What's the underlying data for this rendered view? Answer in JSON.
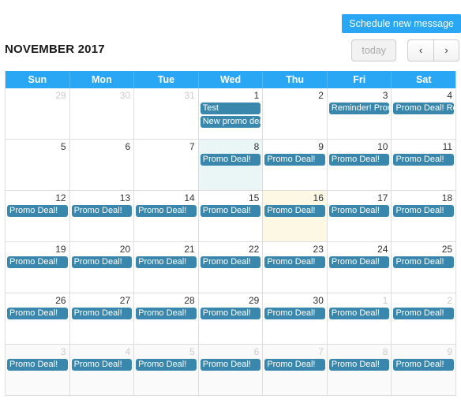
{
  "toolbar": {
    "schedule_label": "Schedule new message"
  },
  "header": {
    "title": "NOVEMBER 2017",
    "today_label": "today",
    "prev_label": "‹",
    "next_label": "›"
  },
  "calendar": {
    "day_names": [
      "Sun",
      "Mon",
      "Tue",
      "Wed",
      "Thu",
      "Fri",
      "Sat"
    ],
    "weeks": [
      [
        {
          "num": "29",
          "state": "other",
          "events": []
        },
        {
          "num": "30",
          "state": "other",
          "events": []
        },
        {
          "num": "31",
          "state": "other",
          "events": []
        },
        {
          "num": "1",
          "state": "current",
          "events": [
            "Test",
            "New promo deal"
          ]
        },
        {
          "num": "2",
          "state": "current",
          "events": []
        },
        {
          "num": "3",
          "state": "current",
          "events": [
            "Reminder! Prom"
          ]
        },
        {
          "num": "4",
          "state": "current",
          "events": [
            "Promo Deal! Rer"
          ]
        }
      ],
      [
        {
          "num": "5",
          "state": "current",
          "events": []
        },
        {
          "num": "6",
          "state": "current",
          "events": []
        },
        {
          "num": "7",
          "state": "current",
          "events": []
        },
        {
          "num": "8",
          "state": "tinted",
          "events": [
            "Promo Deal!"
          ]
        },
        {
          "num": "9",
          "state": "current",
          "events": [
            "Promo Deal!"
          ]
        },
        {
          "num": "10",
          "state": "current",
          "events": [
            "Promo Deal!"
          ]
        },
        {
          "num": "11",
          "state": "current",
          "events": [
            "Promo Deal!"
          ]
        }
      ],
      [
        {
          "num": "12",
          "state": "current",
          "events": [
            "Promo Deal!"
          ]
        },
        {
          "num": "13",
          "state": "current",
          "events": [
            "Promo Deal!"
          ]
        },
        {
          "num": "14",
          "state": "current",
          "events": [
            "Promo Deal!"
          ]
        },
        {
          "num": "15",
          "state": "current",
          "events": [
            "Promo Deal!"
          ]
        },
        {
          "num": "16",
          "state": "today",
          "events": [
            "Promo Deal!"
          ]
        },
        {
          "num": "17",
          "state": "current",
          "events": [
            "Promo Deal!"
          ]
        },
        {
          "num": "18",
          "state": "current",
          "events": [
            "Promo Deal!"
          ]
        }
      ],
      [
        {
          "num": "19",
          "state": "current",
          "events": [
            "Promo Deal!"
          ]
        },
        {
          "num": "20",
          "state": "current",
          "events": [
            "Promo Deal!"
          ]
        },
        {
          "num": "21",
          "state": "current",
          "events": [
            "Promo Deal!"
          ]
        },
        {
          "num": "22",
          "state": "current",
          "events": [
            "Promo Deal!"
          ]
        },
        {
          "num": "23",
          "state": "current",
          "events": [
            "Promo Deal!"
          ]
        },
        {
          "num": "24",
          "state": "current",
          "events": [
            "Promo Deal!"
          ]
        },
        {
          "num": "25",
          "state": "current",
          "events": [
            "Promo Deal!"
          ]
        }
      ],
      [
        {
          "num": "26",
          "state": "current",
          "events": [
            "Promo Deal!"
          ]
        },
        {
          "num": "27",
          "state": "current",
          "events": [
            "Promo Deal!"
          ]
        },
        {
          "num": "28",
          "state": "current",
          "events": [
            "Promo Deal!"
          ]
        },
        {
          "num": "29",
          "state": "current",
          "events": [
            "Promo Deal!"
          ]
        },
        {
          "num": "30",
          "state": "current",
          "events": [
            "Promo Deal!"
          ]
        },
        {
          "num": "1",
          "state": "other",
          "events": [
            "Promo Deal!"
          ]
        },
        {
          "num": "2",
          "state": "other",
          "events": [
            "Promo Deal!"
          ]
        }
      ],
      [
        {
          "num": "3",
          "state": "other-shaded",
          "events": [
            "Promo Deal!"
          ]
        },
        {
          "num": "4",
          "state": "other-shaded",
          "events": [
            "Promo Deal!"
          ]
        },
        {
          "num": "5",
          "state": "other-shaded",
          "events": [
            "Promo Deal!"
          ]
        },
        {
          "num": "6",
          "state": "other-shaded",
          "events": [
            "Promo Deal!"
          ]
        },
        {
          "num": "7",
          "state": "other-shaded",
          "events": [
            "Promo Deal!"
          ]
        },
        {
          "num": "8",
          "state": "other-shaded",
          "events": [
            "Promo Deal!"
          ]
        },
        {
          "num": "9",
          "state": "other-shaded",
          "events": [
            "Promo Deal!"
          ]
        }
      ]
    ]
  },
  "colors": {
    "accent_blue": "#29a7f5",
    "event_blue": "#3a87ad",
    "today_bg": "#fcf8e3",
    "tinted_bg": "#eaf6f6"
  }
}
